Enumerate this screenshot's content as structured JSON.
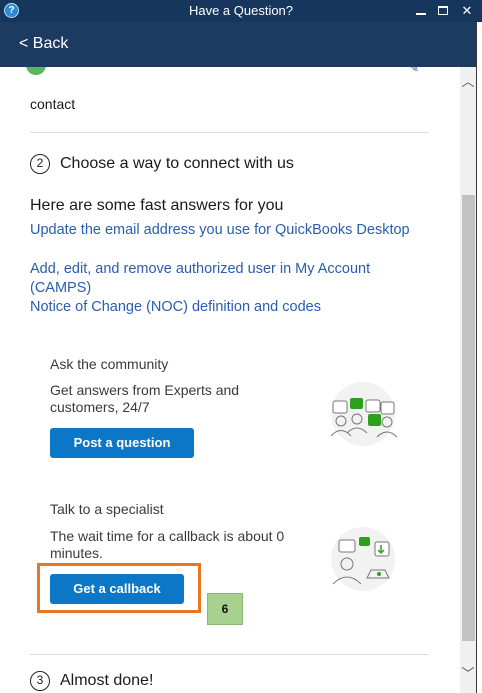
{
  "window": {
    "title": "Have a Question?",
    "app_icon": "?",
    "minimize_icon": "minimize-icon",
    "maximize_icon": "maximize-icon",
    "close_label": "✕"
  },
  "header": {
    "back_label": "< Back"
  },
  "content": {
    "contact_text": "contact",
    "step2": {
      "number": "2",
      "label": "Choose a way to connect with us"
    },
    "fast_answers": {
      "title": "Here are some fast answers for you",
      "links": [
        "Update the email address you use for QuickBooks Desktop",
        "Add, edit, and remove authorized user in My Account (CAMPS)",
        "Notice of Change (NOC) definition and codes"
      ]
    },
    "community": {
      "title": "Ask the community",
      "description": "Get answers from Experts and customers, 24/7",
      "button_label": "Post a question",
      "illustration": "community-chat-illustration"
    },
    "specialist": {
      "title": "Talk to a specialist",
      "description": "The wait time for a callback is about 0 minutes.",
      "button_label": "Get a callback",
      "illustration": "specialist-call-illustration"
    },
    "step_badge": "6",
    "step3": {
      "number": "3",
      "label": "Almost done!"
    }
  },
  "colors": {
    "titlebar": "#17365d",
    "header": "#1d3b61",
    "link": "#2a5db0",
    "button": "#0b77c6",
    "highlight": "#e87722",
    "badge": "#a6d18f"
  }
}
